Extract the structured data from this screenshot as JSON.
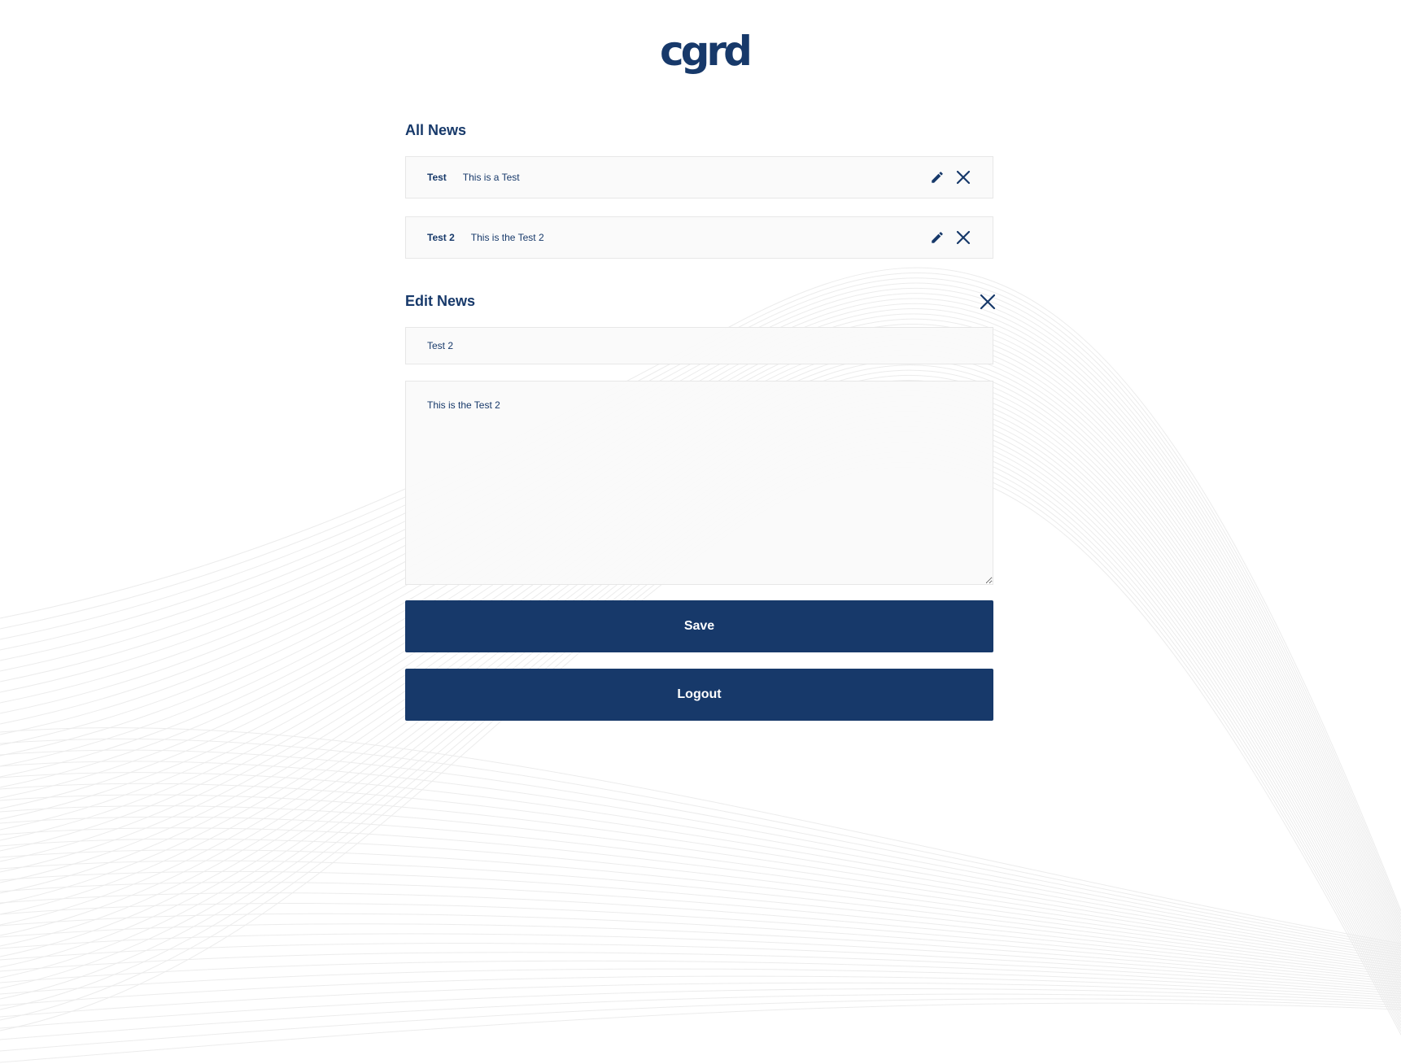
{
  "brand": {
    "logo_text": "cgrd",
    "color": "#17396a"
  },
  "all_news": {
    "heading": "All News",
    "items": [
      {
        "title": "Test",
        "body": "This is a Test",
        "edit_icon": "pencil-icon",
        "delete_icon": "close-icon"
      },
      {
        "title": "Test 2",
        "body": "This is the Test 2",
        "edit_icon": "pencil-icon",
        "delete_icon": "close-icon"
      }
    ]
  },
  "edit_news": {
    "heading": "Edit News",
    "close_icon": "close-icon",
    "title_value": "Test 2",
    "body_value": "This is the Test 2",
    "save_label": "Save"
  },
  "logout_label": "Logout"
}
